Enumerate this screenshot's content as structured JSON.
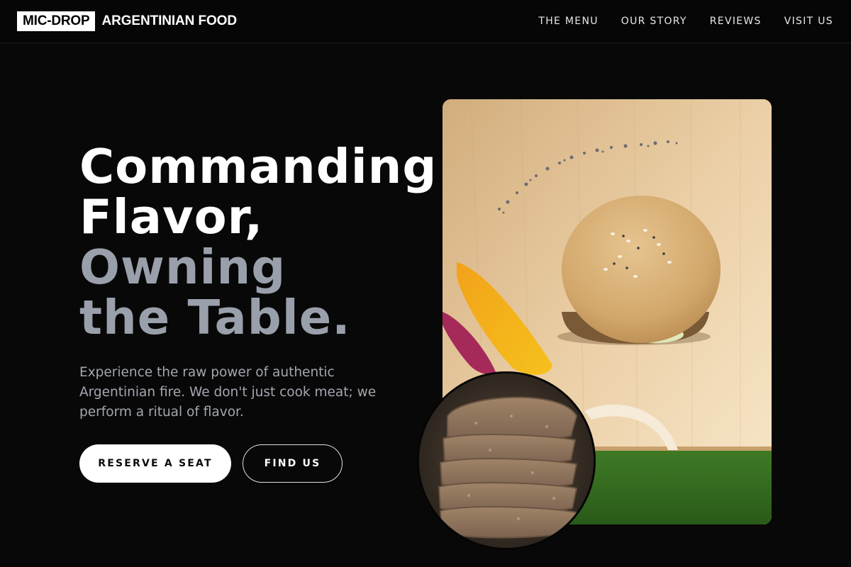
{
  "brand": {
    "tag": "MIC-DROP",
    "name": "ARGENTINIAN FOOD"
  },
  "nav": {
    "items": [
      "THE MENU",
      "OUR STORY",
      "REVIEWS",
      "VISIT US"
    ]
  },
  "hero": {
    "headline_line1": "Commanding",
    "headline_line2": "Flavor,",
    "headline_line3": "Owning",
    "headline_line4": "the Table.",
    "lede": "Experience the raw power of authentic Argentinian fire. We don't just cook meat; we perform a ritual of flavor.",
    "primary_cta": "RESERVE A SEAT",
    "secondary_cta": "FIND US"
  },
  "images": {
    "main": "burger-on-cutting-board",
    "inset": "stacked-bread-slices"
  },
  "colors": {
    "background": "#080808",
    "accent_muted": "#9aa0ab",
    "text": "#ffffff"
  }
}
